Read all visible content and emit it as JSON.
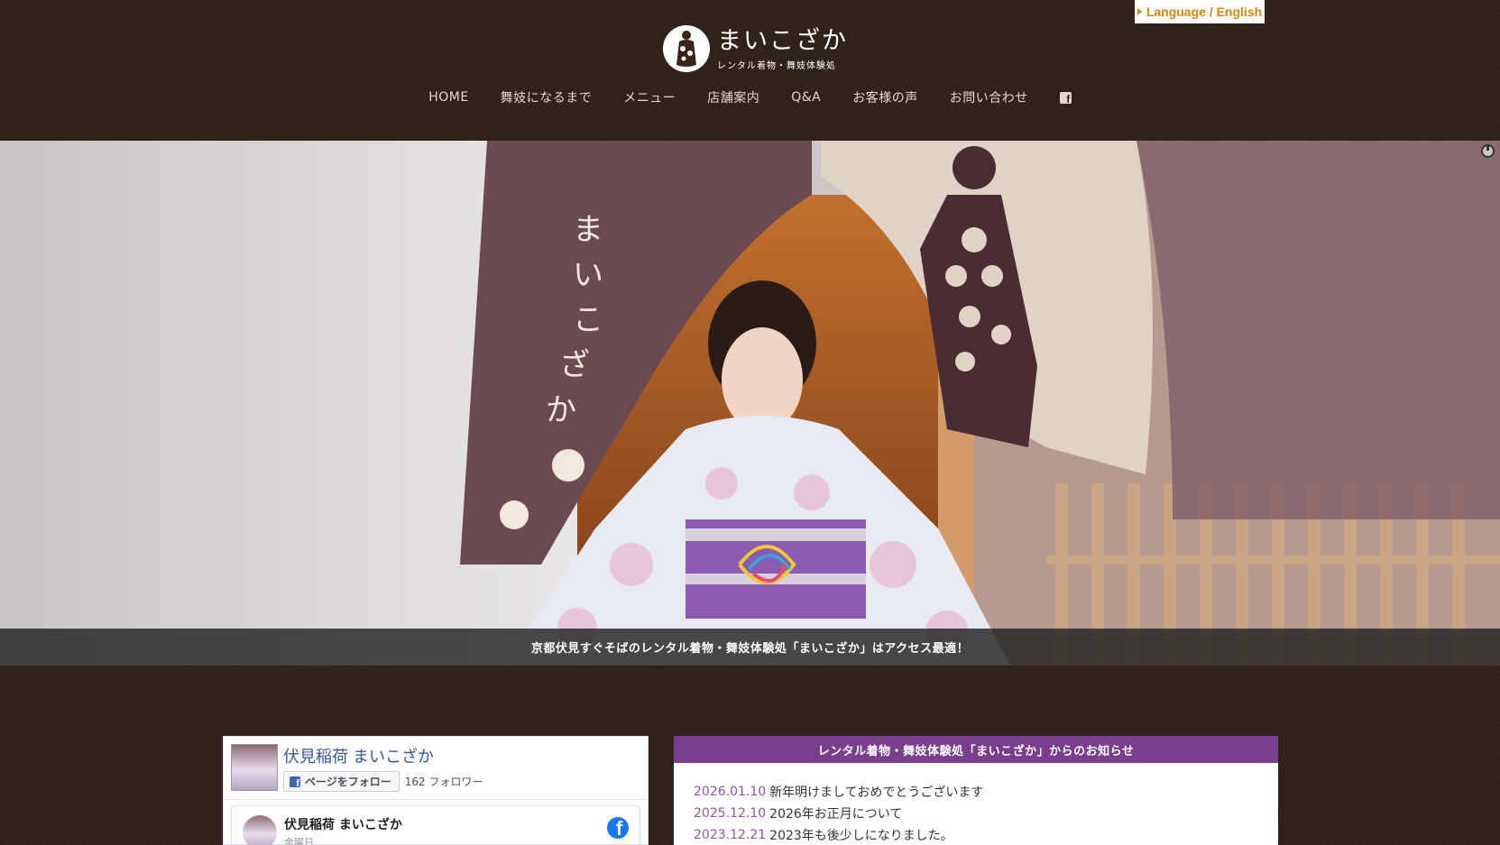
{
  "language_button": {
    "label": "Language / English"
  },
  "logo": {
    "title": "まいこざか",
    "subtitle": "レンタル着物・舞妓体験処"
  },
  "nav": {
    "items": [
      {
        "label": "HOME"
      },
      {
        "label": "舞妓になるまで"
      },
      {
        "label": "メニュー"
      },
      {
        "label": "店舗案内"
      },
      {
        "label": "Q&A"
      },
      {
        "label": "お客様の声"
      },
      {
        "label": "お問い合わせ"
      }
    ],
    "facebook_icon": "facebook-square-icon"
  },
  "hero": {
    "noren_text": "まいこざか",
    "caption": "京都伏見すぐそばのレンタル着物・舞妓体験処「まいこざか」はアクセス最適！"
  },
  "facebook_widget": {
    "page_name": "伏見稲荷 まいこざか",
    "follow_button": "ページをフォロー",
    "followers": "162 フォロワー",
    "post": {
      "name": "伏見稲荷 まいこざか",
      "date": "金曜日"
    }
  },
  "news": {
    "header": "レンタル着物・舞妓体験処「まいこざか」からのお知らせ",
    "items": [
      {
        "date": "2026.01.10",
        "title": "新年明けましておめでとうございます"
      },
      {
        "date": "2025.12.10",
        "title": "2026年お正月について"
      },
      {
        "date": "2023.12.21",
        "title": "2023年も後少しになりました。"
      }
    ]
  },
  "colors": {
    "background": "#2f2118",
    "accent_purple": "#7a3f8c",
    "language_orange": "#d6860f",
    "facebook_blue": "#1877f2"
  }
}
